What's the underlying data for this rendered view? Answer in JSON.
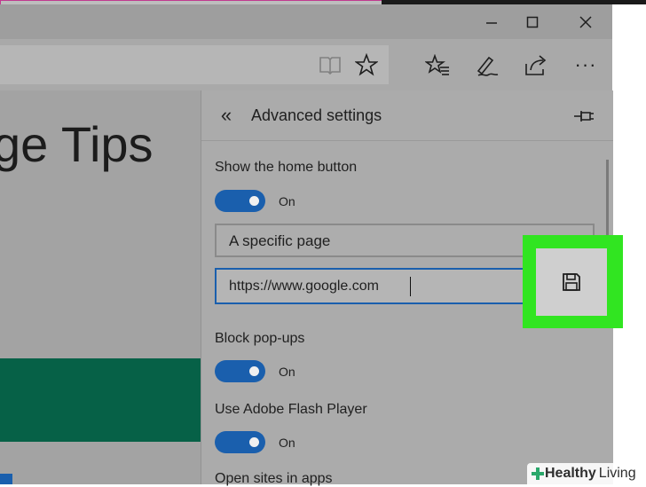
{
  "browser": {
    "window_controls": {
      "minimize": "—",
      "maximize": "☐",
      "close": "✕"
    },
    "more_label": "···"
  },
  "page": {
    "heading": "ge Tips"
  },
  "settings_panel": {
    "title": "Advanced settings",
    "home_button": {
      "label": "Show the home button",
      "toggle_state": "On",
      "select_value": "A specific page",
      "url_value": "https://www.google.com"
    },
    "block_popups": {
      "label": "Block pop-ups",
      "toggle_state": "On"
    },
    "flash": {
      "label": "Use Adobe Flash Player",
      "toggle_state": "On"
    },
    "open_sites": {
      "label": "Open sites in apps"
    }
  },
  "icons": [
    "reading-view-icon",
    "favorite-star-icon",
    "favorites-hub-icon",
    "web-note-pen-icon",
    "share-icon",
    "more-icon",
    "back-chevron-icon",
    "pin-icon",
    "save-floppy-icon",
    "watermark-plus-icon"
  ],
  "colors": {
    "accent": "#1a5fad",
    "highlight": "#31e521",
    "band": "#066147"
  },
  "watermark": {
    "part1": "Healthy",
    "part2": "Living"
  }
}
